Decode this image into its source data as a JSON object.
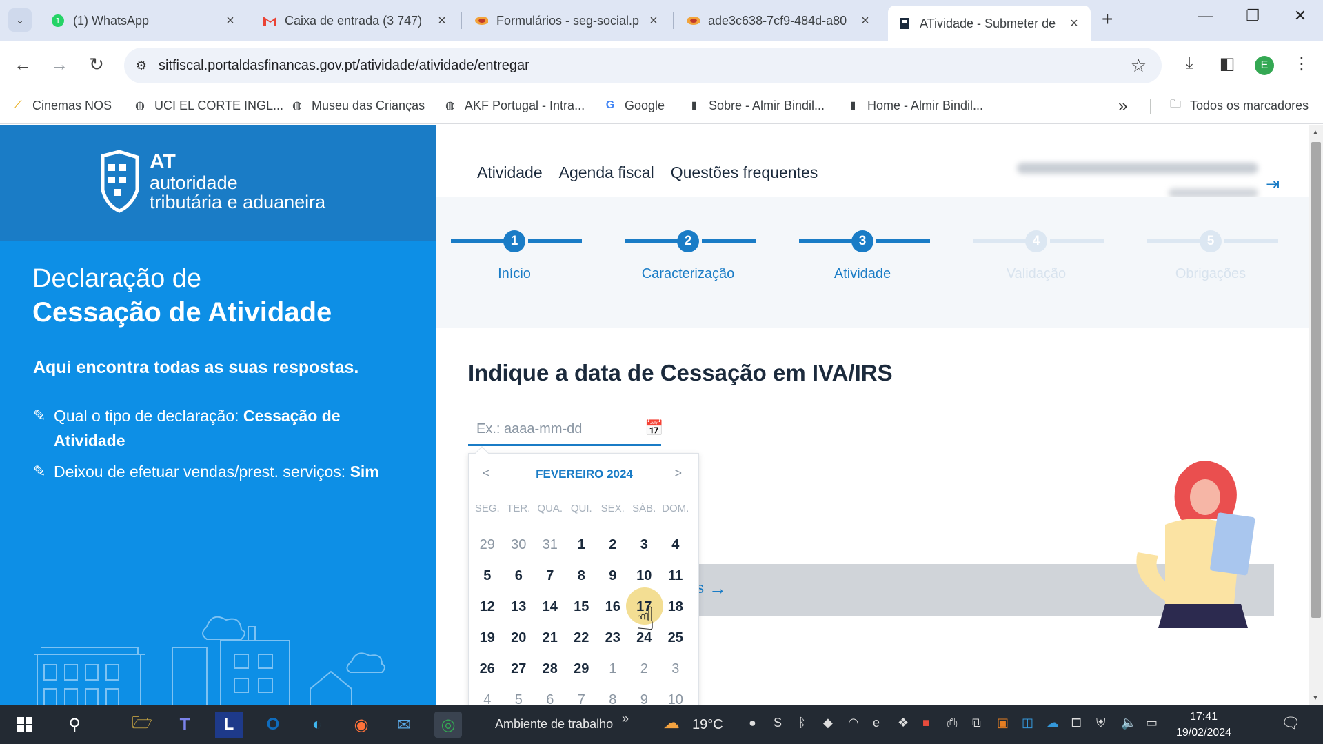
{
  "browser": {
    "tabs": [
      {
        "title": "(1) WhatsApp",
        "favicon": "whatsapp-icon",
        "active": false
      },
      {
        "title": "Caixa de entrada (3 747)",
        "favicon": "gmail-icon",
        "active": false
      },
      {
        "title": "Formulários - seg-social.p",
        "favicon": "seg-social-icon",
        "active": false
      },
      {
        "title": "ade3c638-7cf9-484d-a80",
        "favicon": "seg-social-icon",
        "active": false
      },
      {
        "title": "ATividade - Submeter de",
        "favicon": "at-icon",
        "active": true
      }
    ],
    "url": "sitfiscal.portaldasfinancas.gov.pt/atividade/atividade/entregar",
    "profile_initial": "E",
    "bookmarks": [
      {
        "label": "Cinemas NOS",
        "icon": "cinemas-icon"
      },
      {
        "label": "UCI EL CORTE INGL...",
        "icon": "globe-icon"
      },
      {
        "label": "Museu das Crianças",
        "icon": "globe-icon"
      },
      {
        "label": "AKF Portugal - Intra...",
        "icon": "globe-icon"
      },
      {
        "label": "Google",
        "icon": "google-icon"
      },
      {
        "label": "Sobre - Almir Bindil...",
        "icon": "page-icon"
      },
      {
        "label": "Home - Almir Bindil...",
        "icon": "page-icon"
      }
    ],
    "all_bookmarks": "Todos os marcadores"
  },
  "brand": {
    "abbr": "AT",
    "line1": "autoridade",
    "line2": "tributária e aduaneira"
  },
  "sidebar": {
    "title_light": "Declaração de",
    "title_bold": "Cessação de Atividade",
    "subtitle": "Aqui encontra todas as suas respostas.",
    "qa": [
      {
        "question": "Qual o tipo de declaração: ",
        "answer": "Cessação de Atividade"
      },
      {
        "question": "Deixou de efetuar vendas/prest. serviços: ",
        "answer": "Sim"
      }
    ]
  },
  "header": {
    "nav": [
      "Atividade",
      "Agenda fiscal",
      "Questões frequentes"
    ]
  },
  "steps": [
    {
      "num": "1",
      "label": "Início",
      "state": "done"
    },
    {
      "num": "2",
      "label": "Caracterização",
      "state": "done"
    },
    {
      "num": "3",
      "label": "Atividade",
      "state": "current"
    },
    {
      "num": "4",
      "label": "Validação",
      "state": "disabled"
    },
    {
      "num": "5",
      "label": "Obrigações",
      "state": "disabled"
    }
  ],
  "form": {
    "question": "Indique a data de Cessação em IVA/IRS",
    "date_placeholder": "Ex.: aaaa-mm-dd",
    "next_text": "s"
  },
  "calendar": {
    "prev": "<",
    "next": ">",
    "month_label": "FEVEREIRO 2024",
    "weekdays": [
      "SEG.",
      "TER.",
      "QUA.",
      "QUI.",
      "SEX.",
      "SÁB.",
      "DOM."
    ],
    "days": [
      [
        "29",
        "30",
        "31",
        "1",
        "2",
        "3",
        "4"
      ],
      [
        "5",
        "6",
        "7",
        "8",
        "9",
        "10",
        "11"
      ],
      [
        "12",
        "13",
        "14",
        "15",
        "16",
        "17",
        "18"
      ],
      [
        "19",
        "20",
        "21",
        "22",
        "23",
        "24",
        "25"
      ],
      [
        "26",
        "27",
        "28",
        "29",
        "1",
        "2",
        "3"
      ],
      [
        "4",
        "5",
        "6",
        "7",
        "8",
        "9",
        "10"
      ]
    ],
    "today": "19",
    "hovered": "17"
  },
  "taskbar": {
    "workspace": "Ambiente de trabalho",
    "temperature": "19°C",
    "time": "17:41",
    "date": "19/02/2024"
  },
  "colors": {
    "brand_blue": "#1a7cc6",
    "sidebar_blue": "#0d8fe6"
  }
}
